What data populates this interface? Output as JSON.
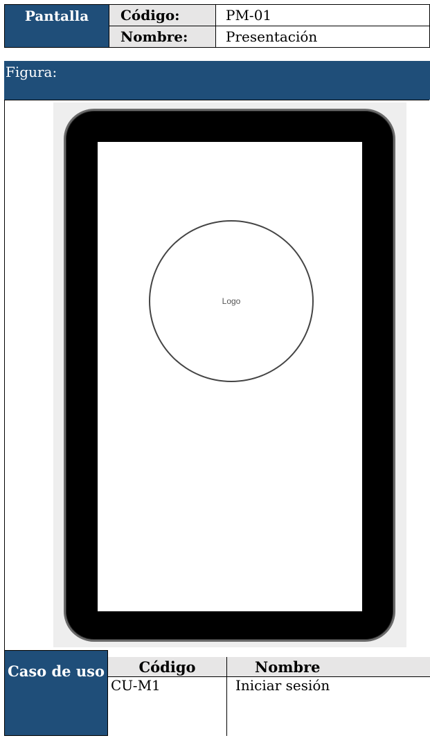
{
  "header": {
    "label": "Pantalla",
    "codigo_key": "Código:",
    "codigo_val": "PM-01",
    "nombre_key": "Nombre:",
    "nombre_val": "Presentación"
  },
  "figura_label": "Figura:",
  "mockup": {
    "logo_text": "Logo"
  },
  "caso_de_uso": {
    "label": "Caso de uso",
    "columns": [
      "Código",
      "Nombre"
    ],
    "rows": [
      {
        "codigo": "CU-M1",
        "nombre": "Iniciar sesión"
      }
    ]
  },
  "colors": {
    "header_blue": "#1f4e79",
    "key_gray": "#e7e6e6"
  }
}
